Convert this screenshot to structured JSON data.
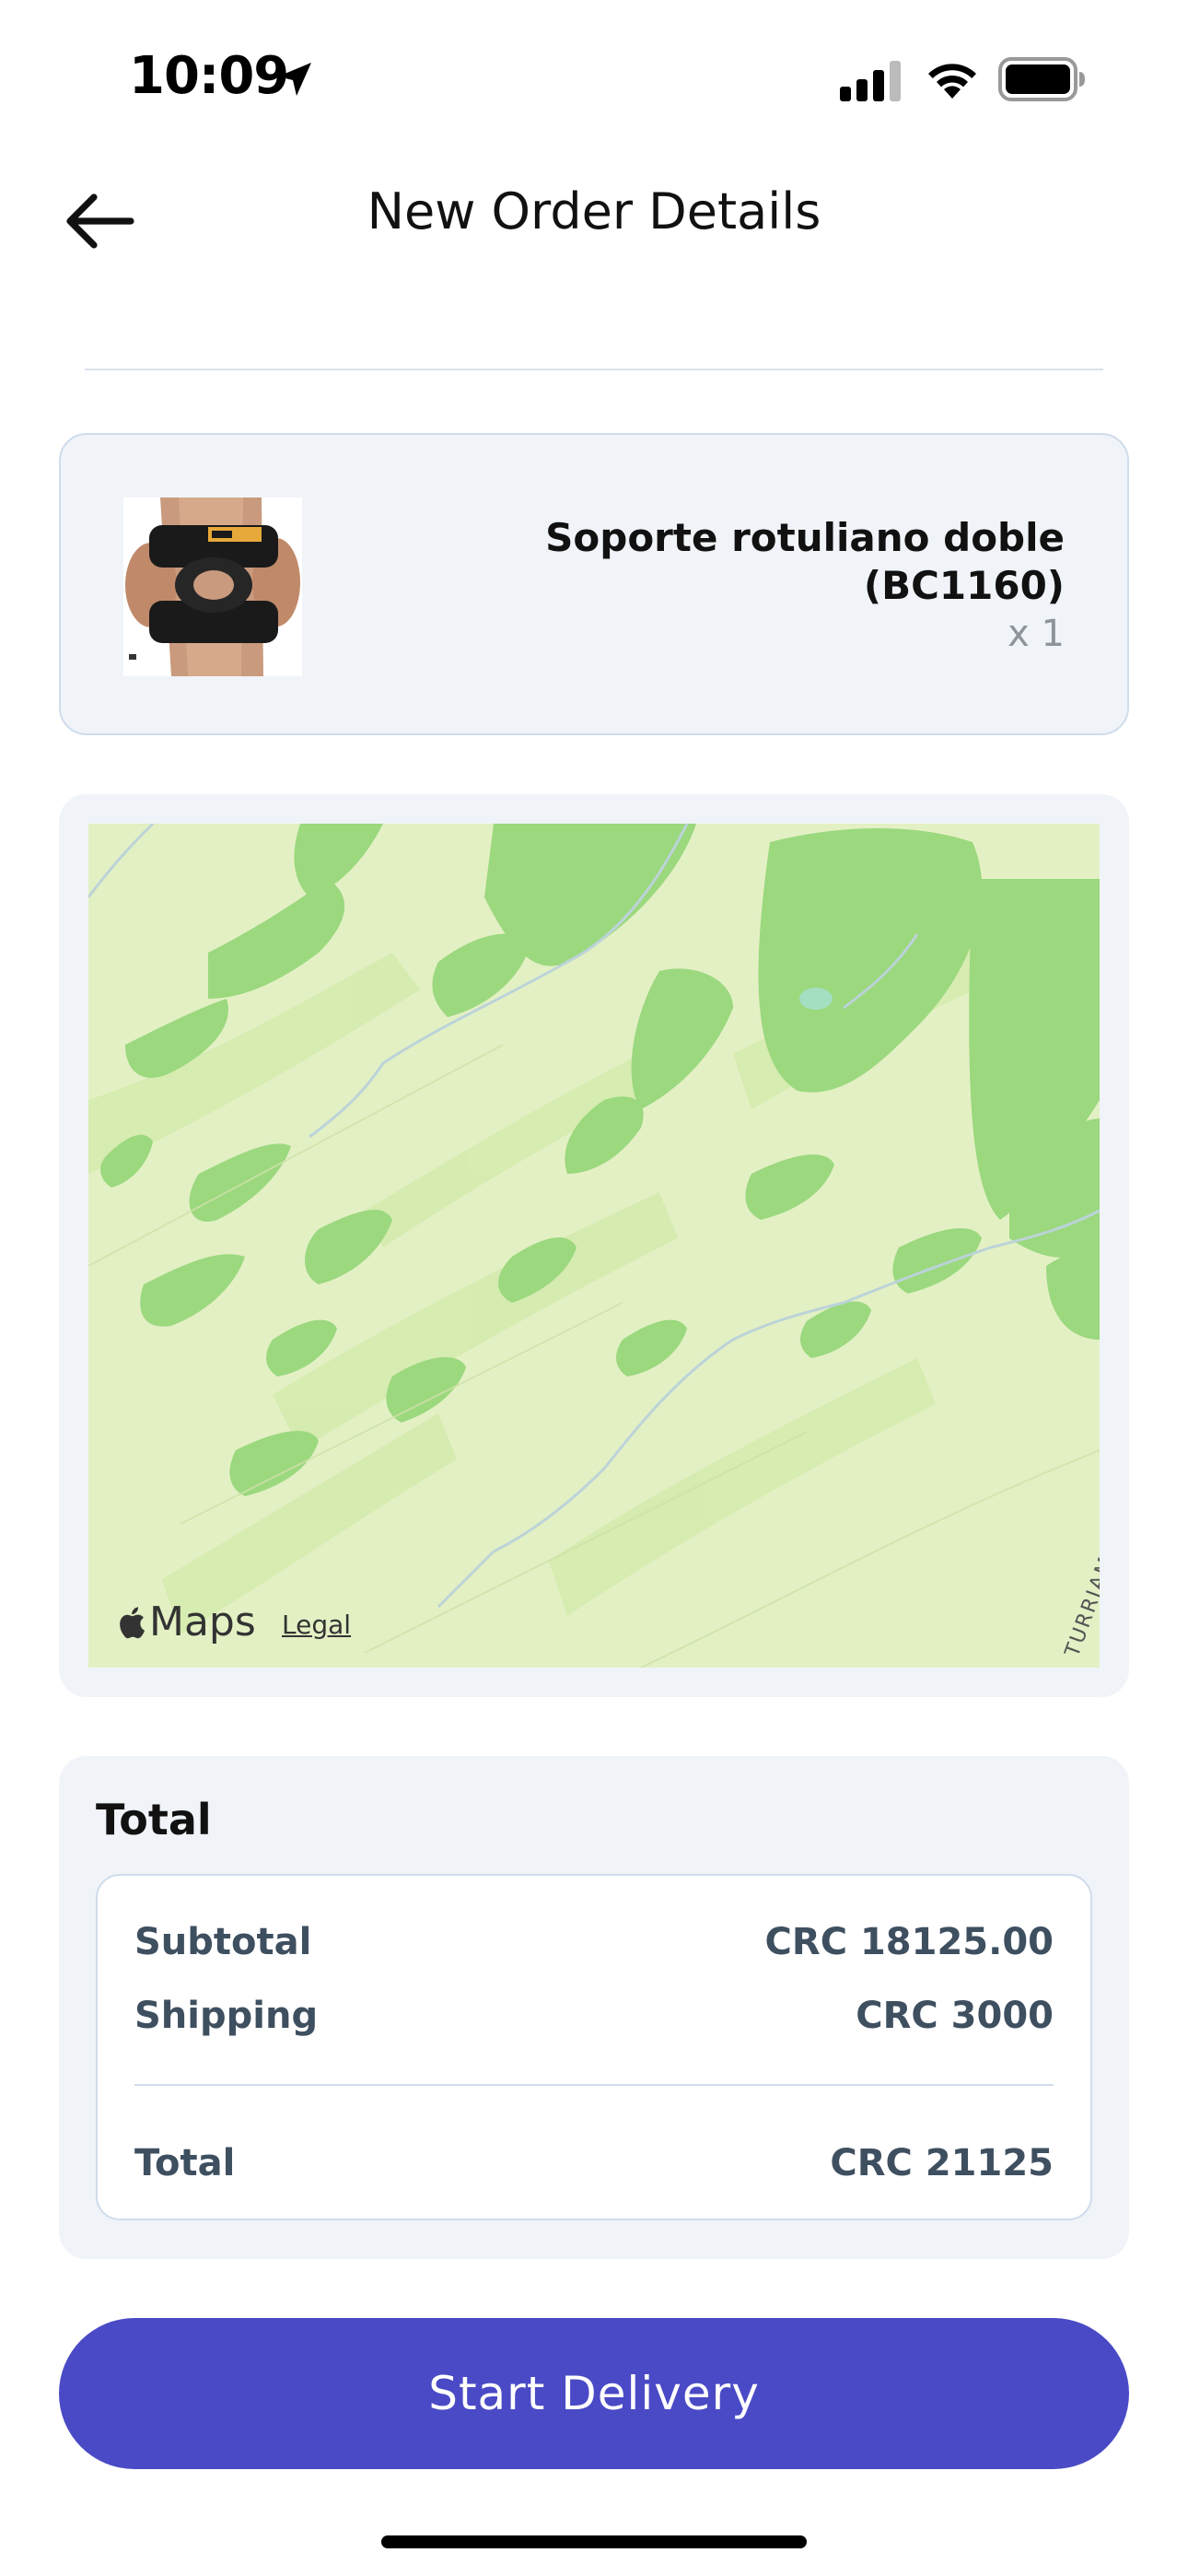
{
  "status_bar": {
    "time": "10:09",
    "icons": [
      "location-arrow-icon",
      "cellular-signal-icon",
      "wifi-icon",
      "battery-icon"
    ]
  },
  "header": {
    "back_icon": "arrow-left-icon",
    "title": "New Order Details"
  },
  "product": {
    "name": "Soporte  rotuliano doble (BC1160)",
    "quantity": "x 1",
    "image": "knee-brace-photo"
  },
  "map": {
    "logo_text": "Maps",
    "legal_label": "Legal",
    "street_label": "TURRIAMBA"
  },
  "totals": {
    "heading": "Total",
    "subtotal_label": "Subtotal",
    "subtotal_value": "CRC 18125.00",
    "shipping_label": "Shipping",
    "shipping_value": "CRC 3000",
    "total_label": "Total",
    "total_value": "CRC 21125"
  },
  "actions": {
    "start_delivery_label": "Start Delivery"
  },
  "colors": {
    "primary_button": "#4a4ac6",
    "card_background": "#f0f4f9",
    "card_border": "#cfdceb",
    "totals_text": "#3e4f60",
    "map_base": "#e3f0c4",
    "map_forest": "#9bd87e"
  }
}
